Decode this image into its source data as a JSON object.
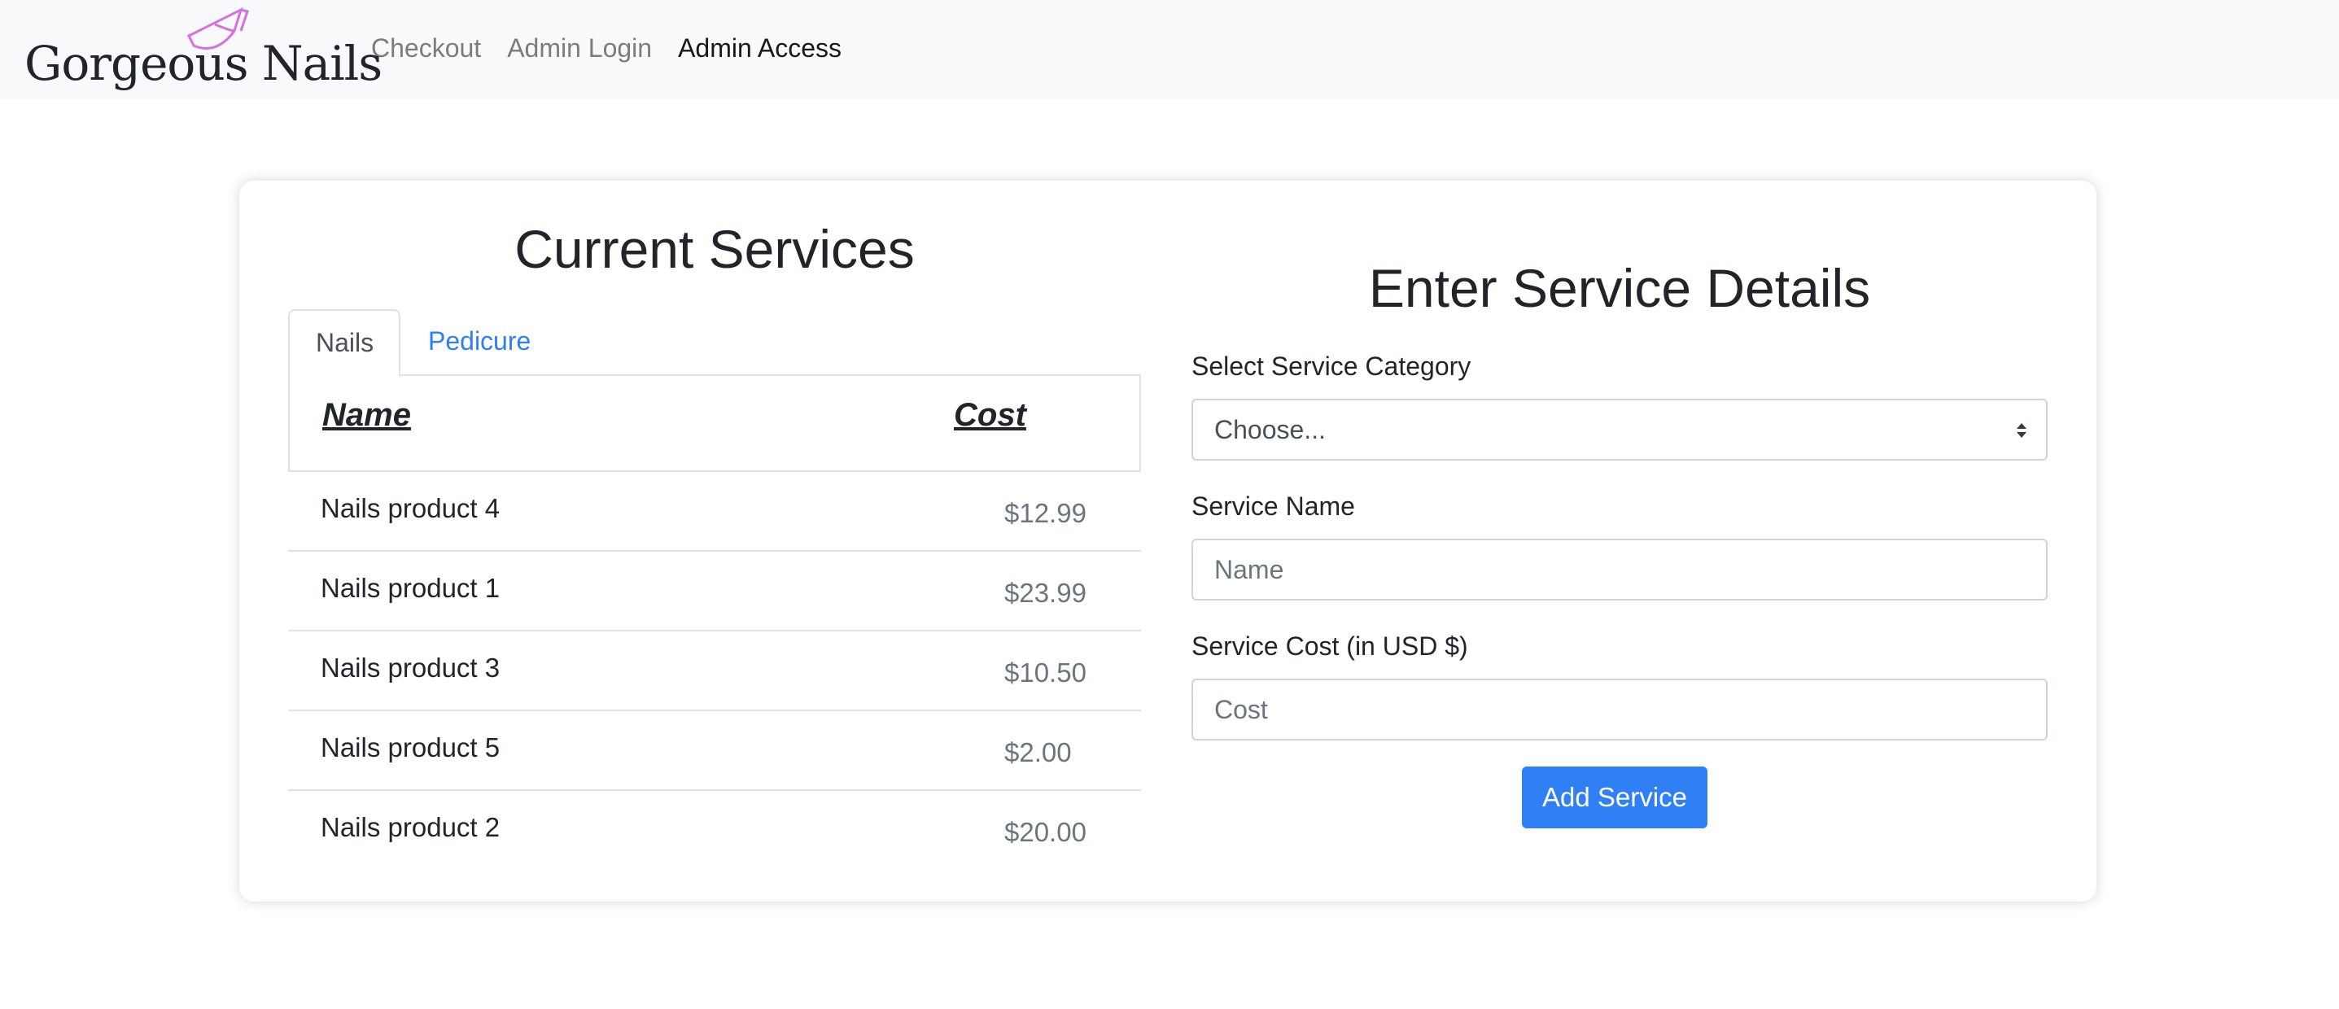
{
  "brand": {
    "name": "Gorgeous Nails",
    "accent": "#d86fe0"
  },
  "nav": {
    "links": [
      {
        "label": "Checkout",
        "active": false
      },
      {
        "label": "Admin Login",
        "active": false
      },
      {
        "label": "Admin Access",
        "active": true
      }
    ]
  },
  "services": {
    "title": "Current Services",
    "tabs": [
      {
        "label": "Nails",
        "active": true
      },
      {
        "label": "Pedicure",
        "active": false
      }
    ],
    "columns": {
      "name": "Name",
      "cost": "Cost"
    },
    "rows": [
      {
        "name": "Nails product 4",
        "cost": "$12.99"
      },
      {
        "name": "Nails product 1",
        "cost": "$23.99"
      },
      {
        "name": "Nails product 3",
        "cost": "$10.50"
      },
      {
        "name": "Nails product 5",
        "cost": "$2.00"
      },
      {
        "name": "Nails product 2",
        "cost": "$20.00"
      }
    ]
  },
  "form": {
    "title": "Enter Service Details",
    "category": {
      "label": "Select Service Category",
      "value": "Choose..."
    },
    "name": {
      "label": "Service Name",
      "placeholder": "Name"
    },
    "cost": {
      "label": "Service Cost (in USD $)",
      "placeholder": "Cost"
    },
    "submit_label": "Add Service"
  },
  "colors": {
    "primary": "#2f7ff5",
    "navbar_bg": "#f8f9fa"
  }
}
